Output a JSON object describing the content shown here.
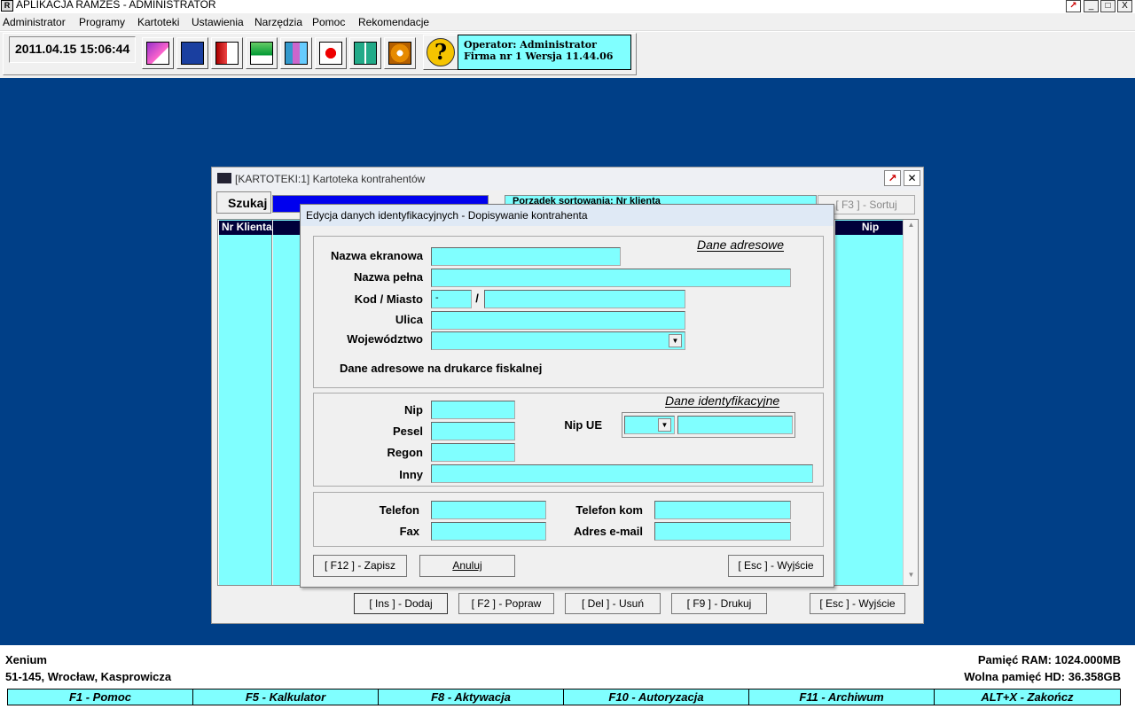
{
  "window": {
    "title": "APLIKACJA RAMZES - ADMINISTRATOR",
    "minimize": "_",
    "maximize": "□",
    "close": "X"
  },
  "menu": [
    "Administrator",
    "Programy",
    "Kartoteki",
    "Ustawienia",
    "Narzędzia",
    "Pomoc",
    "Rekomendacje"
  ],
  "toolbar": {
    "datetime": "2011.04.15 15:06:44",
    "help": "?",
    "operator_line": "Operator: Administrator",
    "firm_line": "Firma nr 1   Wersja 11.44.06"
  },
  "kartoteka": {
    "title": "[KARTOTEKI:1]  Kartoteka kontrahentów",
    "search_label": "Szukaj",
    "sort_text": "Porządek sortowania: Nr klienta",
    "sort_button": "[ F3 ] - Sortuj",
    "col_nr": "Nr Klienta",
    "col_nip": "Nip",
    "buttons": {
      "add": "[ Ins ] - Dodaj",
      "edit": "[ F2 ] - Popraw",
      "delete": "[ Del ] - Usuń",
      "print": "[ F9 ] - Drukuj",
      "exit": "[ Esc ] - Wyjście"
    }
  },
  "dialog": {
    "title": "Edycja danych identyfikacyjnych   - Dopisywanie kontrahenta",
    "address_group": "Dane adresowe",
    "labels": {
      "screen_name": "Nazwa ekranowa",
      "full_name": "Nazwa pełna",
      "code_city": "Kod / Miasto",
      "street": "Ulica",
      "province": "Województwo",
      "fiscal": "Dane adresowe na drukarce fiskalnej",
      "nip": "Nip",
      "pesel": "Pesel",
      "regon": "Regon",
      "other": "Inny",
      "nip_ue": "Nip UE",
      "phone": "Telefon",
      "fax": "Fax",
      "mobile": "Telefon kom",
      "email": "Adres e-mail"
    },
    "postal_code_value": "-",
    "code_city_separator": "/",
    "id_group": "Dane identyfikacyjne",
    "buttons": {
      "save": "[ F12 ] - Zapisz",
      "cancel": "Anuluj",
      "exit": "[ Esc ] - Wyjście"
    }
  },
  "status": {
    "company": "Xenium",
    "address": "51-145, Wrocław, Kasprowicza",
    "ram": "Pamięć RAM: 1024.000MB",
    "disk": "Wolna pamięć HD: 36.358GB"
  },
  "fkeys": [
    "F1 - Pomoc",
    "F5 - Kalkulator",
    "F8 - Aktywacja",
    "F10 - Autoryzacja",
    "F11 - Archiwum",
    "ALT+X - Zakończ"
  ],
  "colors": {
    "desktop": "#003f87",
    "field": "#80ffff",
    "grid_header": "#00003a",
    "search": "#0000ee"
  }
}
